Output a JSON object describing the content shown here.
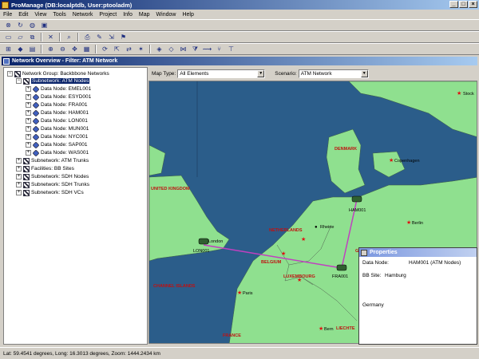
{
  "app": {
    "title": "ProManage (DB:localptdb, User:ptooladm)",
    "window_buttons": [
      "_",
      "□",
      "×"
    ]
  },
  "menu": [
    "File",
    "Edit",
    "View",
    "Tools",
    "Network",
    "Project",
    "Info",
    "Map",
    "Window",
    "Help"
  ],
  "child_window": {
    "title": "Network Overview - Filter: ATM Network"
  },
  "tree": {
    "root": "Network Group: Backbbone Networks",
    "subnet_atm_nodes": "Subnetwork: ATM Nodes",
    "data_nodes": [
      "Data Node: EMEL001",
      "Data Node: ESYD001",
      "Data Node: FRA001",
      "Data Node: HAM001",
      "Data Node: LON001",
      "Data Node: MUN001",
      "Data Node: NYC001",
      "Data Node: SAP001",
      "Data Node: WAS001"
    ],
    "others": [
      "Subnetwork: ATM Trunks",
      "Facilities: BB Sites",
      "Subnetwork: SDH Nodes",
      "Subnetwork: SDH Trunks",
      "Subnetwork: SDH VCs"
    ]
  },
  "map_controls": {
    "map_type_label": "Map Type:",
    "map_type_value": "All Elements",
    "scenario_label": "Scenario:",
    "scenario_value": "ATM Network"
  },
  "map": {
    "colors": {
      "sea": "#2b5d8a",
      "land": "#8fe08f",
      "link": "#c040c0",
      "city": "#e01010"
    },
    "countries": [
      "UNITED KINGDOM",
      "DENMARK",
      "NETHERLANDS",
      "BELGIUM",
      "LUXEMBOURG",
      "FRANCE",
      "LIECHTE",
      "CHANNEL ISLANDS",
      "G"
    ],
    "cities": [
      "Stock",
      "Copenhagen",
      "Berlin",
      "Rheine",
      "London",
      "Paris",
      "Bern"
    ],
    "nodes": [
      "HAM001",
      "LON001",
      "FRA001"
    ]
  },
  "properties": {
    "title": "Properties",
    "data_node_label": "Data Node:",
    "data_node_value": "HAM001 (ATM Nodes)",
    "bb_site_label": "BB Site:",
    "bb_site_value": "Hamburg",
    "country_value": "Germany"
  },
  "status": {
    "text": "Lat: 59.4541 degrees, Long: 16.3013 degrees, Zoom: 1444.2434 km"
  }
}
